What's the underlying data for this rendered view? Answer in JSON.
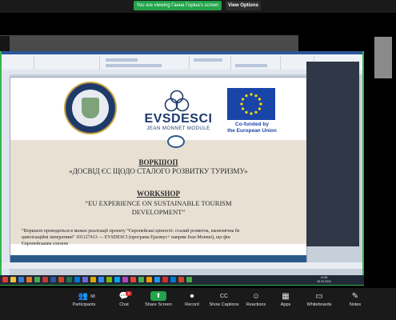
{
  "zoom_top": {
    "viewing_label": "You are viewing Ганна Горіна's screen",
    "view_options_label": "View Options"
  },
  "slide": {
    "evs_name": "EVSDESCI",
    "evs_sub": "JEAN MONNET MODULE",
    "eu_line1": "Co-funded by",
    "eu_line2": "the European Union",
    "ua_title": "ВОРКШОП",
    "ua_subtitle": "«ДОСВІД ЄС ЩОДО СТАЛОГО РОЗВИТКУ ТУРИЗМУ»",
    "en_title": "WORKSHOP",
    "en_subtitle_line1": "“EU EXPERIENCE ON SUSTAINABLE TOURISM",
    "en_subtitle_line2": "DEVELOPMENT”",
    "note_line1": "“Воркшоп проводиться в межах реалізації проєкту “Європейські цінності: сталий розвиток, економічна бе",
    "note_line2": "цивілізаційні імперативи” 101127413 — EVSDESCI (програма Еразмус+ напрям Jean Monnet), що фін",
    "note_line3": "Європейським союзом"
  },
  "taskbar": {
    "time": "14:55",
    "date": "26.03.2024"
  },
  "zoom_bottom": {
    "participants_label": "Participants",
    "participants_count": "68",
    "chat_label": "Chat",
    "chat_badge": "8",
    "share_label": "Share Screen",
    "record_label": "Record",
    "captions_label": "Show Captions",
    "reactions_label": "Reactions",
    "apps_label": "Apps",
    "whiteboards_label": "Whiteboards",
    "notes_label": "Notes"
  },
  "colors": {
    "zoom_green": "#23a34a",
    "slide_navy": "#1d3a6b",
    "eu_blue": "#1a45a8"
  }
}
